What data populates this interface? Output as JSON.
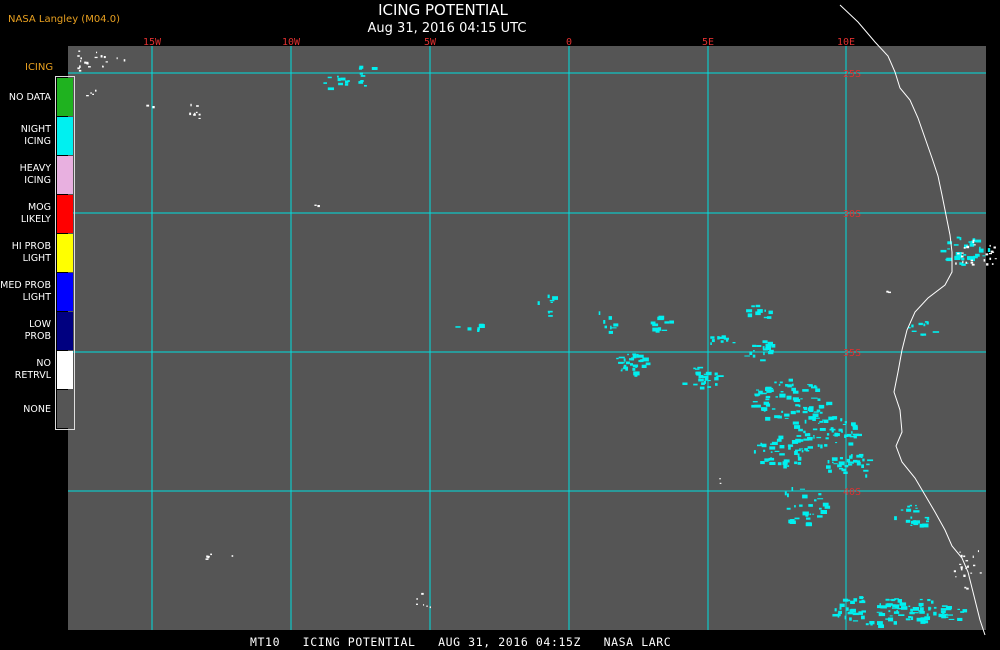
{
  "header": {
    "credit": "NASA Langley (M04.0)",
    "title": "ICING POTENTIAL",
    "date": "Aug 31, 2016 04:15 UTC"
  },
  "footer": "MT10   ICING POTENTIAL   AUG 31, 2016 04:15Z   NASA LARC",
  "legend": {
    "title": "ICING",
    "items": [
      {
        "label1": "NO DATA",
        "label2": "",
        "color": "#1fb21f"
      },
      {
        "label1": "NIGHT",
        "label2": "ICING",
        "color": "#00f0f0"
      },
      {
        "label1": "HEAVY",
        "label2": "ICING",
        "color": "#e8b0e0"
      },
      {
        "label1": "MOG",
        "label2": "LIKELY",
        "color": "#ff0000"
      },
      {
        "label1": "HI PROB",
        "label2": "LIGHT",
        "color": "#ffff00"
      },
      {
        "label1": "MED PROB",
        "label2": "LIGHT",
        "color": "#0000ff"
      },
      {
        "label1": "LOW",
        "label2": "PROB",
        "color": "#000080"
      },
      {
        "label1": "NO",
        "label2": "RETRVL",
        "color": "#ffffff"
      },
      {
        "label1": "NONE",
        "label2": "",
        "color": "#555555"
      }
    ]
  },
  "grid": {
    "longitude_labels": [
      "15W",
      "10W",
      "5W",
      "0",
      "5E",
      "10E"
    ],
    "latitude_labels": [
      "25S",
      "30S",
      "35S",
      "40S"
    ],
    "line_color": "#00e0e0",
    "tick_color": "#e03030"
  },
  "colors": {
    "background": "#000000",
    "ocean": "#555555",
    "coast": "#ffffff",
    "night_icing": "#00f0f0"
  }
}
